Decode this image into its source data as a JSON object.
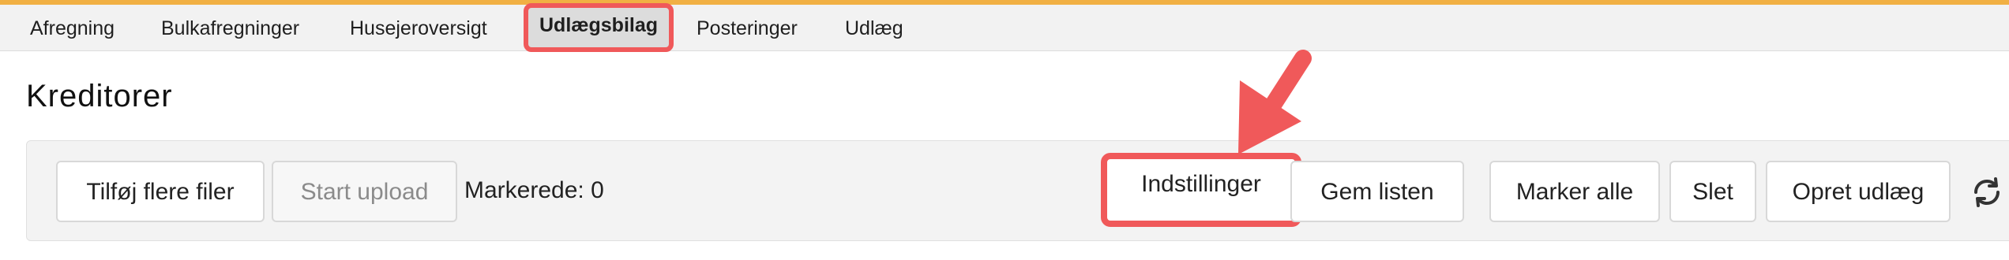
{
  "nav": {
    "items": [
      {
        "label": "Afregning"
      },
      {
        "label": "Bulkafregninger"
      },
      {
        "label": "Husejeroversigt"
      },
      {
        "label": "Udlægsbilag",
        "active": true
      },
      {
        "label": "Posteringer"
      },
      {
        "label": "Udlæg"
      }
    ]
  },
  "page": {
    "title": "Kreditorer"
  },
  "toolbar": {
    "add_files_label": "Tilføj flere filer",
    "start_upload_label": "Start upload",
    "marked_text": "Markerede: 0",
    "settings_label": "Indstillinger",
    "save_list_label": "Gem listen",
    "mark_all_label": "Marker alle",
    "delete_label": "Slet",
    "create_expense_label": "Opret udlæg",
    "refresh_icon": "refresh-icon"
  },
  "colors": {
    "accent_top": "#f1b044",
    "highlight": "#f0595a",
    "nav_bg": "#f2f2f2",
    "toolbar_bg": "#f3f3f3"
  }
}
